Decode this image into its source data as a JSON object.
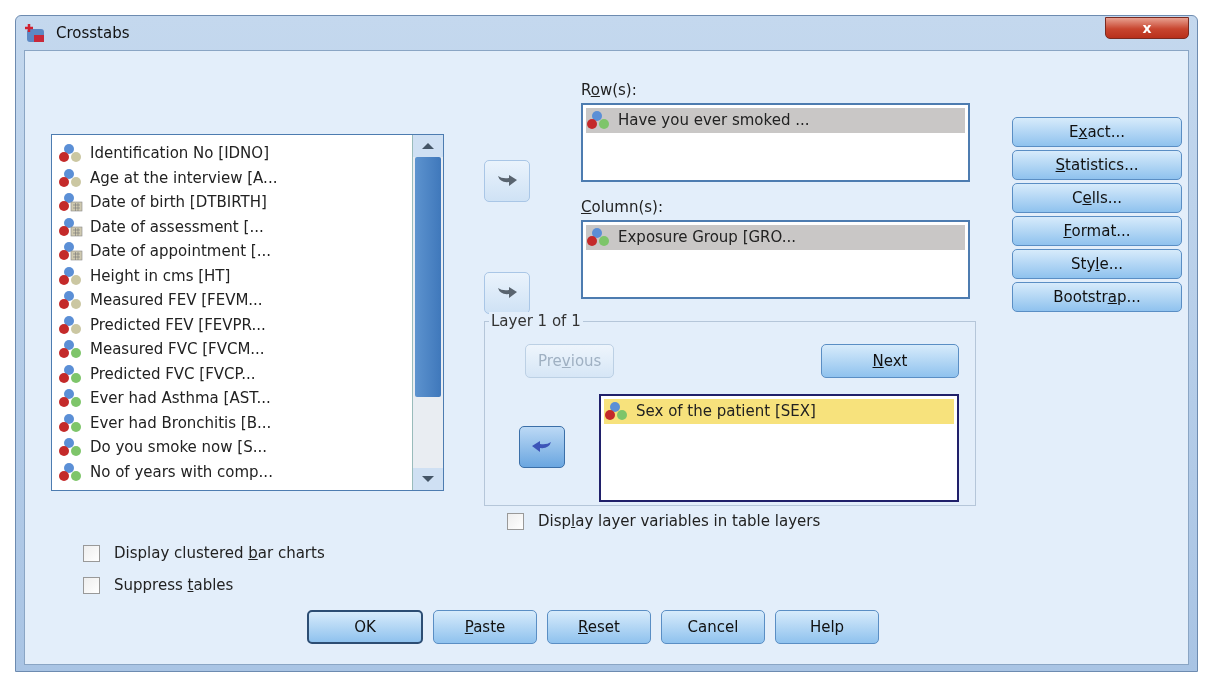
{
  "window": {
    "title": "Crosstabs",
    "close": "x"
  },
  "variables": [
    {
      "label": "Identification No [IDNO]",
      "kind": "scale"
    },
    {
      "label": "Age at the interview [A...",
      "kind": "scale"
    },
    {
      "label": "Date of birth [DTBIRTH]",
      "kind": "date"
    },
    {
      "label": "Date of assessment [...",
      "kind": "date"
    },
    {
      "label": "Date of appointment [...",
      "kind": "date"
    },
    {
      "label": "Height in cms [HT]",
      "kind": "scale"
    },
    {
      "label": "Measured FEV [FEVM...",
      "kind": "scale"
    },
    {
      "label": "Predicted FEV [FEVPR...",
      "kind": "scale"
    },
    {
      "label": "Measured FVC [FVCM...",
      "kind": "nominal"
    },
    {
      "label": "Predicted FVC [FVCP...",
      "kind": "nominal"
    },
    {
      "label": "Ever had Asthma [AST...",
      "kind": "nominal"
    },
    {
      "label": "Ever had Bronchitis [B...",
      "kind": "nominal"
    },
    {
      "label": "Do you smoke now [S...",
      "kind": "nominal"
    },
    {
      "label": "No of years with comp...",
      "kind": "nominal"
    }
  ],
  "rows": {
    "label": {
      "before": "R",
      "key": "o",
      "after": "w(s):"
    },
    "items": [
      {
        "label": "Have you ever smoked ...",
        "kind": "nominal",
        "selected": true
      }
    ]
  },
  "columns": {
    "label": {
      "key": "C",
      "after": "olumn(s):"
    },
    "items": [
      {
        "label": "Exposure Group [GRO...",
        "kind": "nominal",
        "selected": true
      }
    ]
  },
  "layer": {
    "title": "Layer 1 of 1",
    "focused": true,
    "previous": {
      "label": {
        "before": "Pre",
        "key": "v",
        "after": "ious"
      },
      "disabled": true
    },
    "next": {
      "label": {
        "key": "N",
        "after": "ext"
      },
      "disabled": false
    },
    "items": [
      {
        "label": "Sex of the patient [SEX]",
        "kind": "nominal",
        "selected": true
      }
    ]
  },
  "side_buttons": [
    {
      "label": {
        "before": "E",
        "key": "x",
        "after": "act..."
      }
    },
    {
      "label": {
        "key": "S",
        "after": "tatistics..."
      }
    },
    {
      "label": {
        "before": "C",
        "key": "e",
        "after": "lls..."
      }
    },
    {
      "label": {
        "key": "F",
        "after": "ormat..."
      }
    },
    {
      "label": {
        "before": "Sty",
        "key": "l",
        "after": "e..."
      }
    },
    {
      "label": {
        "before": "Bootstr",
        "key": "a",
        "after": "p..."
      }
    }
  ],
  "layer_option": {
    "label": {
      "before": "Disp",
      "key": "l",
      "after": "ay layer variables in table layers"
    },
    "checked": false
  },
  "options": [
    {
      "label": {
        "before": "Display clustered ",
        "key": "b",
        "after": "ar charts"
      },
      "checked": false
    },
    {
      "label": {
        "before": "Suppress ",
        "key": "t",
        "after": "ables"
      },
      "checked": false
    }
  ],
  "buttons": [
    {
      "label": "OK",
      "default": true
    },
    {
      "label": {
        "key": "P",
        "after": "aste"
      },
      "default": false
    },
    {
      "label": {
        "key": "R",
        "after": "eset"
      },
      "default": false
    },
    {
      "label": "Cancel",
      "default": false
    },
    {
      "label": "Help",
      "default": false
    }
  ]
}
